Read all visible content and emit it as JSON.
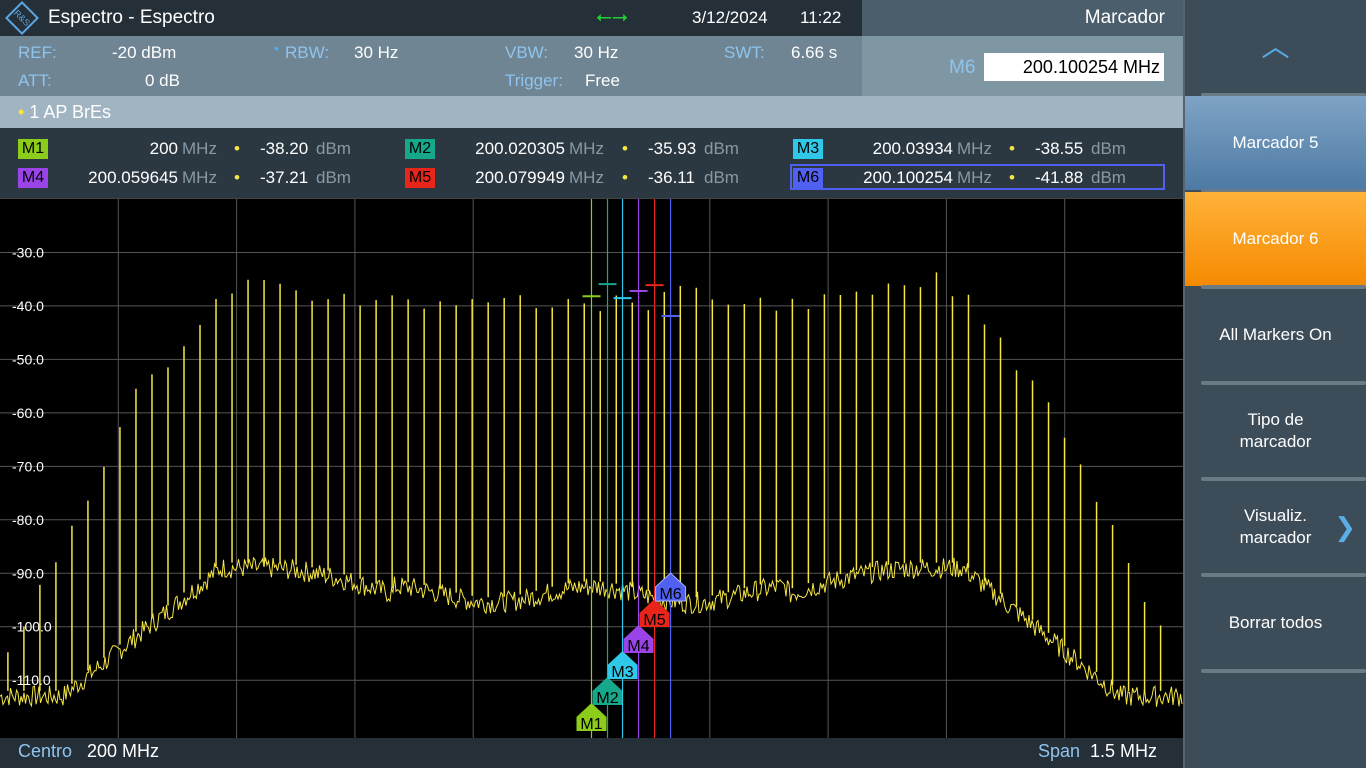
{
  "header": {
    "title": "Espectro - Espectro",
    "date": "3/12/2024",
    "time": "11:22"
  },
  "params": {
    "ref_label": "REF:",
    "ref": "-20 dBm",
    "att_label": "ATT:",
    "att": "0 dB",
    "rbw_label": "RBW:",
    "rbw": "30 Hz",
    "vbw_label": "VBW:",
    "vbw": "30 Hz",
    "trigger_label": "Trigger:",
    "trigger": "Free",
    "swt_label": "SWT:",
    "swt": "6.66 s"
  },
  "marker_panel": {
    "title": "Marcador",
    "active_label": "M6",
    "active_value": "200.100254 MHz"
  },
  "trace": {
    "label": "1 AP  BrEs"
  },
  "markers": [
    {
      "name": "M1",
      "freq": "200",
      "level": "-38.20",
      "color": "#8ccc1a",
      "offset_khz": 0
    },
    {
      "name": "M2",
      "freq": "200.020305",
      "level": "-35.93",
      "color": "#15a88a",
      "offset_khz": 20.305
    },
    {
      "name": "M3",
      "freq": "200.03934",
      "level": "-38.55",
      "color": "#30c8e8",
      "offset_khz": 39.34
    },
    {
      "name": "M4",
      "freq": "200.059645",
      "level": "-37.21",
      "color": "#9a44e8",
      "offset_khz": 59.645
    },
    {
      "name": "M5",
      "freq": "200.079949",
      "level": "-36.11",
      "color": "#e8251a",
      "offset_khz": 79.949
    },
    {
      "name": "M6",
      "freq": "200.100254",
      "level": "-41.88",
      "color": "#5060f0",
      "offset_khz": 100.254
    }
  ],
  "units": {
    "freq": "MHz",
    "level": "dBm"
  },
  "chart_data": {
    "type": "line",
    "ylim": [
      -121,
      -20
    ],
    "xlim_khz": [
      -750,
      750
    ],
    "yticks": [
      "-30.0",
      "-40.0",
      "-50.0",
      "-60.0",
      "-70.0",
      "-80.0",
      "-90.0",
      "-100.0",
      "-110.0"
    ],
    "center_label": "Centro",
    "center": "200 MHz",
    "span_label": "Span",
    "span": "1.5 MHz",
    "trace_color": "#f5e642"
  },
  "sidebar": {
    "items": [
      "Marcador 5",
      "Marcador 6",
      "All Markers On",
      "Tipo de\nmarcador",
      "Visualiz.\nmarcador",
      "Borrar todos"
    ]
  }
}
